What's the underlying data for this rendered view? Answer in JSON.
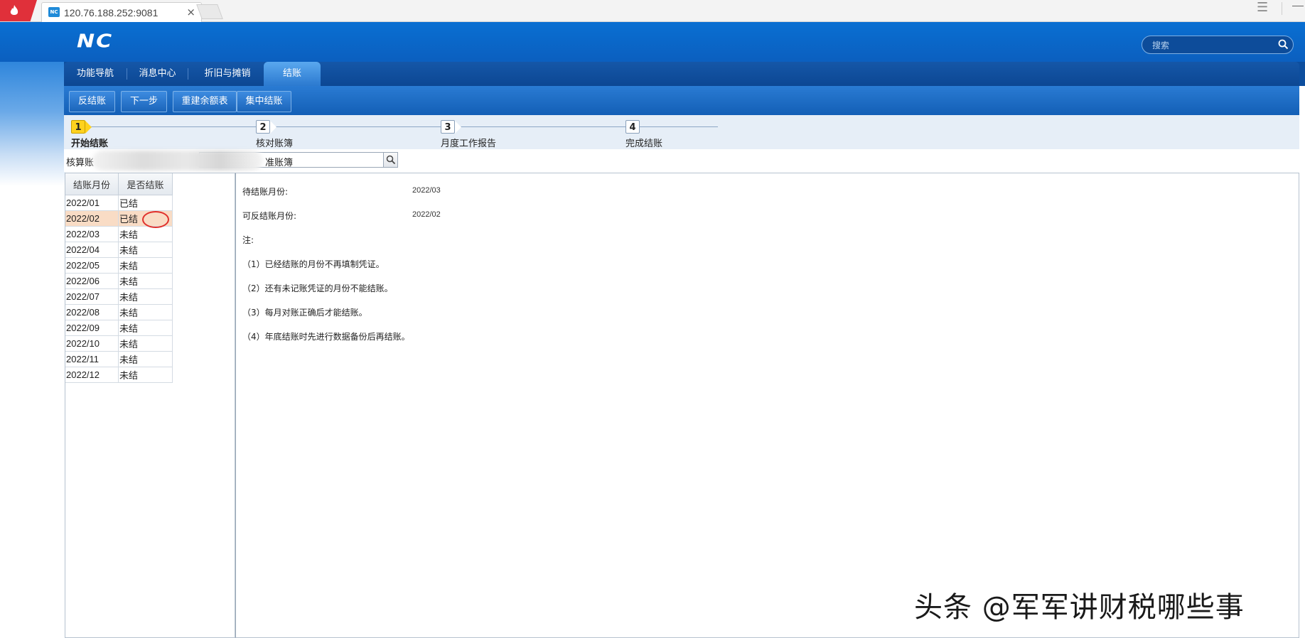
{
  "browser": {
    "tab_url": "120.76.188.252:9081",
    "favicon_text": "NC",
    "close_glyph": "×",
    "menu_glyph": "☰"
  },
  "header": {
    "logo": "NC",
    "search_placeholder": "搜索"
  },
  "module_tabs": [
    {
      "label": "功能导航",
      "active": false
    },
    {
      "label": "消息中心",
      "active": false
    },
    {
      "label": "折旧与摊销",
      "active": false
    },
    {
      "label": "结账",
      "active": true
    }
  ],
  "toolbar": {
    "buttons": [
      "反结账",
      "下一步",
      "重建余额表",
      "集中结账"
    ]
  },
  "steps": [
    {
      "num": "1",
      "label": "开始结账",
      "current": true
    },
    {
      "num": "2",
      "label": "核对账簿",
      "current": false
    },
    {
      "num": "3",
      "label": "月度工作报告",
      "current": false
    },
    {
      "num": "4",
      "label": "完成结账",
      "current": false
    }
  ],
  "account_book": {
    "label": "核算账",
    "value": "准账簿"
  },
  "month_table": {
    "headers": [
      "结账月份",
      "是否结账"
    ],
    "rows": [
      {
        "month": "2022/01",
        "status": "已结"
      },
      {
        "month": "2022/02",
        "status": "已结",
        "selected": true
      },
      {
        "month": "2022/03",
        "status": "未结"
      },
      {
        "month": "2022/04",
        "status": "未结"
      },
      {
        "month": "2022/05",
        "status": "未结"
      },
      {
        "month": "2022/06",
        "status": "未结"
      },
      {
        "month": "2022/07",
        "status": "未结"
      },
      {
        "month": "2022/08",
        "status": "未结"
      },
      {
        "month": "2022/09",
        "status": "未结"
      },
      {
        "month": "2022/10",
        "status": "未结"
      },
      {
        "month": "2022/11",
        "status": "未结"
      },
      {
        "month": "2022/12",
        "status": "未结"
      }
    ]
  },
  "info": {
    "pending_label": "待结账月份:",
    "pending_value": "2022/03",
    "reverse_label": "可反结账月份:",
    "reverse_value": "2022/02",
    "note_title": "注:",
    "notes": [
      "（1）已经结账的月份不再填制凭证。",
      "（2）还有未记账凭证的月份不能结账。",
      "（3）每月对账正确后才能结账。",
      "（4）年底结账时先进行数据备份后再结账。"
    ]
  },
  "watermark": "头条 @军军讲财税哪些事",
  "colors": {
    "header_blue": "#0a6fd2",
    "selected_row": "#f9dcc5",
    "current_step": "#ffd21f",
    "annotation_red": "#e0302c"
  }
}
